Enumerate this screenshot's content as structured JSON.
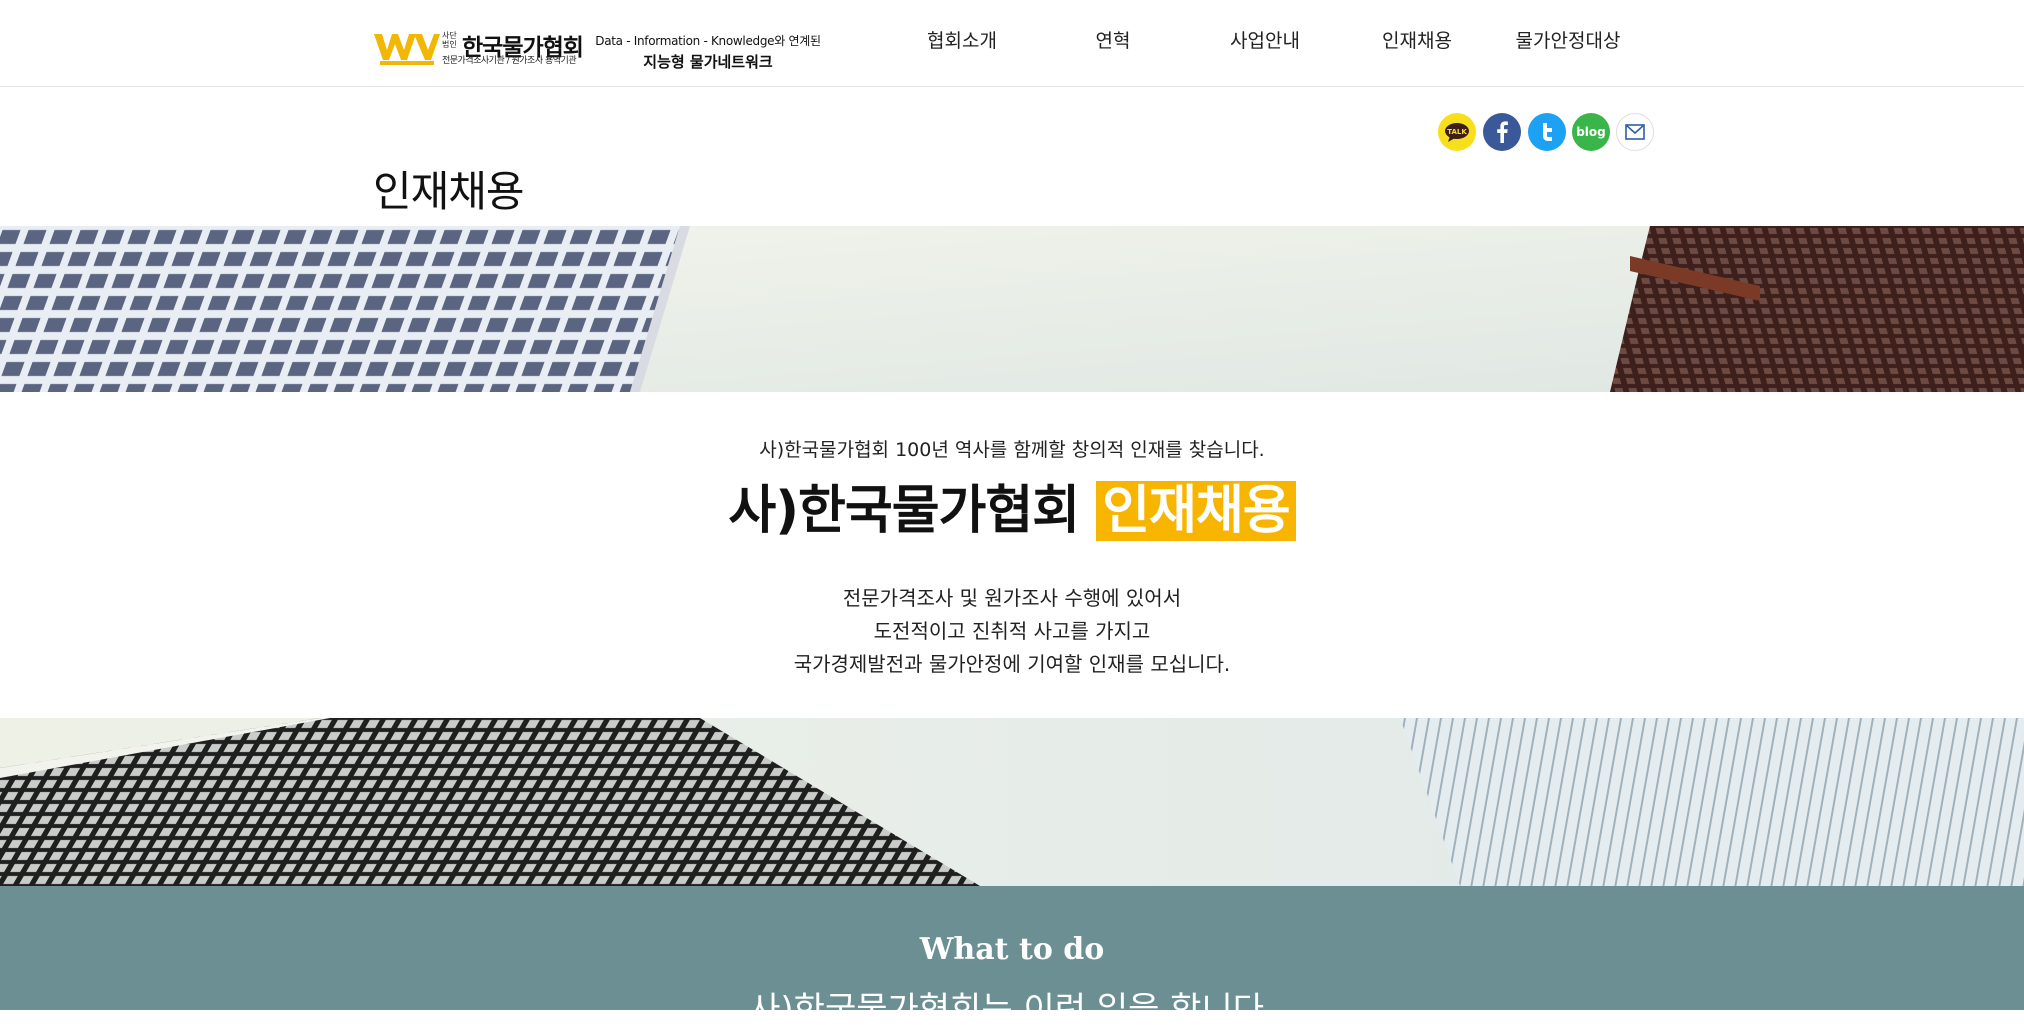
{
  "header": {
    "logo": {
      "sub": "사단\n법인",
      "name": "한국물가협회",
      "tagline": "전문가격조사기관 / 원가조사 용역기관",
      "mark_color": "#f2b705"
    },
    "slogan": {
      "line1": "Data - Information - Knowledge와 연계된",
      "line2": "지능형 물가네트워크"
    },
    "nav": [
      {
        "label": "협회소개"
      },
      {
        "label": "연혁"
      },
      {
        "label": "사업안내"
      },
      {
        "label": "인재채용"
      },
      {
        "label": "물가안정대상"
      }
    ]
  },
  "page": {
    "title": "인재채용"
  },
  "sns": {
    "kakao_label": "TALK",
    "blog_label": "blog"
  },
  "intro": {
    "lead": "사)한국물가협회 100년 역사를 함께할 창의적 인재를 찾습니다.",
    "headline_plain": "사)한국물가협회",
    "headline_highlight": "인재채용",
    "highlight_color": "#f7b500",
    "desc": [
      "전문가격조사 및 원가조사 수행에 있어서",
      "도전적이고 진취적 사고를 가지고",
      "국가경제발전과 물가안정에 기여할 인재를 모십니다."
    ]
  },
  "what_to_do": {
    "title": "What to do",
    "subtitle": "사)한국물가협회는 이런 일을 합니다.",
    "bg_color": "#6b8f93"
  }
}
